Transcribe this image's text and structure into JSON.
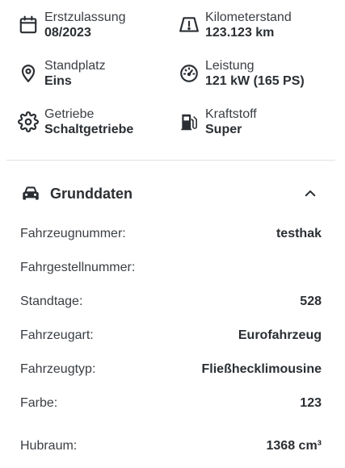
{
  "specs": {
    "registration": {
      "label": "Erstzulassung",
      "value": "08/2023",
      "icon": "calendar-icon"
    },
    "mileage": {
      "label": "Kilometerstand",
      "value": "123.123 km",
      "icon": "speed-warning-icon"
    },
    "location": {
      "label": "Standplatz",
      "value": "Eins",
      "icon": "location-pin-icon"
    },
    "power": {
      "label": "Leistung",
      "value": "121 kW (165 PS)",
      "icon": "gauge-icon"
    },
    "gearbox": {
      "label": "Getriebe",
      "value": "Schaltgetriebe",
      "icon": "gear-icon"
    },
    "fuel": {
      "label": "Kraftstoff",
      "value": "Super",
      "icon": "fuel-pump-icon"
    }
  },
  "section": {
    "title": "Grunddaten",
    "icon": "car-icon",
    "toggle_icon": "chevron-up-icon",
    "rows": [
      {
        "key": "Fahrzeugnummer:",
        "value": "testhak"
      },
      {
        "key": "Fahrgestellnummer:",
        "value": ""
      },
      {
        "key": "Standtage:",
        "value": "528"
      },
      {
        "key": "Fahrzeugart:",
        "value": "Eurofahrzeug"
      },
      {
        "key": "Fahrzeugtyp:",
        "value": "Fließhecklimousine"
      },
      {
        "key": "Farbe:",
        "value": "123"
      },
      {
        "key": "Hubraum:",
        "value": "1368 cm³"
      }
    ]
  },
  "colors": {
    "text": "#2b2f33",
    "label": "#3a3e43",
    "divider": "#dde0e3"
  }
}
